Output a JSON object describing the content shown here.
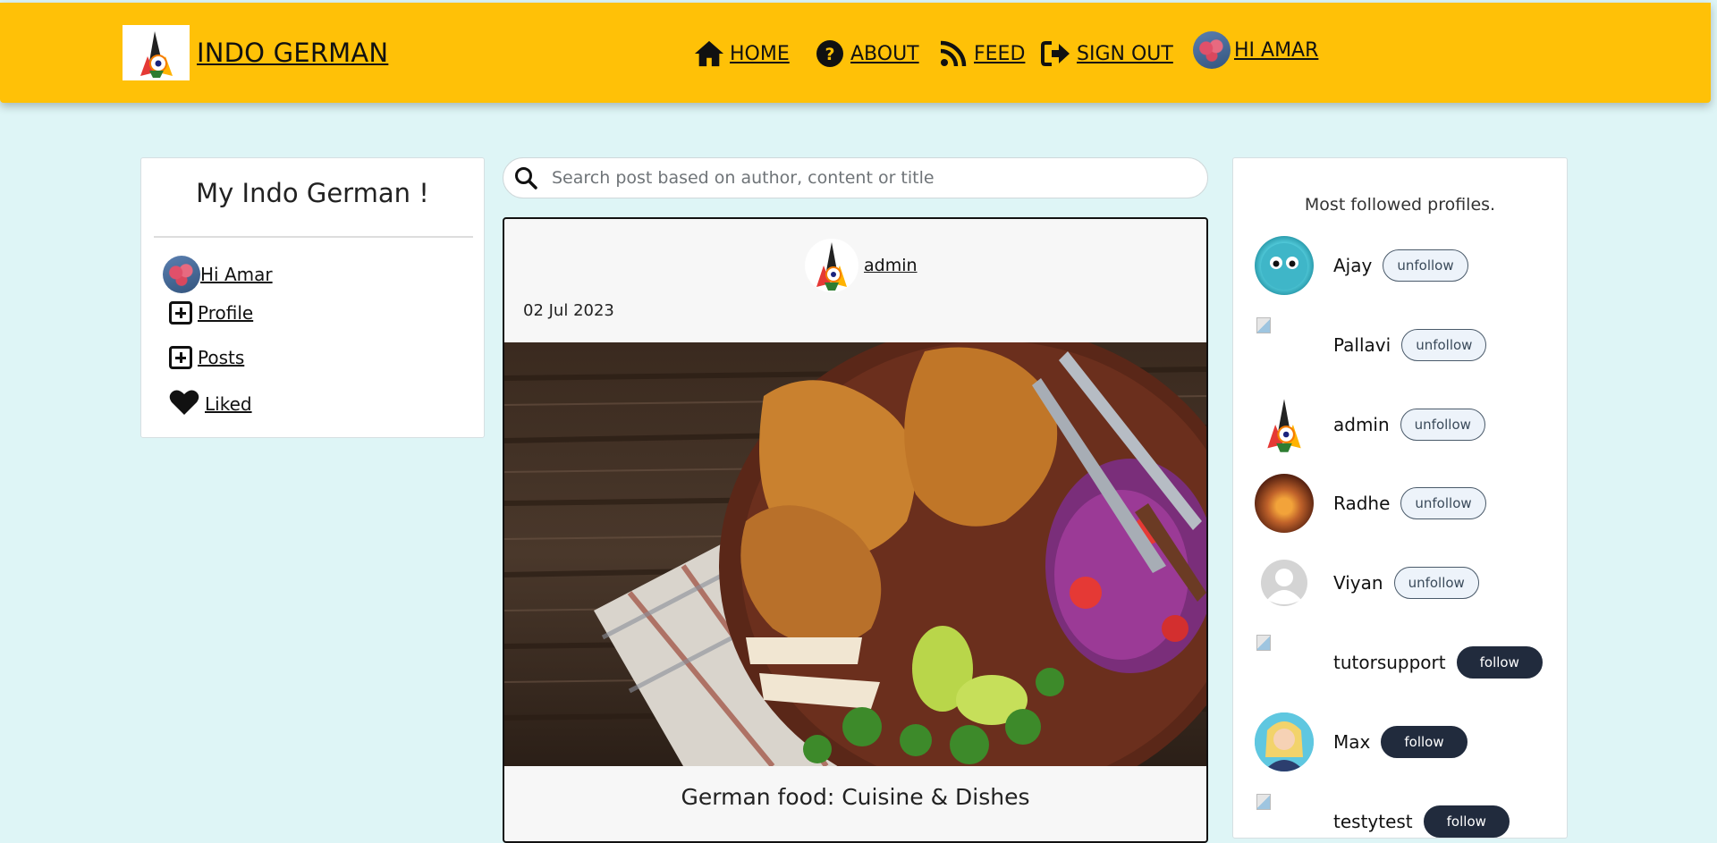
{
  "header": {
    "brand": "INDO GERMAN",
    "nav": [
      {
        "label": "HOME",
        "icon": "home-icon"
      },
      {
        "label": "ABOUT",
        "icon": "question-circle-icon"
      },
      {
        "label": "FEED",
        "icon": "rss-icon"
      },
      {
        "label": "SIGN OUT",
        "icon": "sign-out-icon"
      },
      {
        "label": " HI AMAR",
        "icon": "avatar"
      }
    ]
  },
  "left": {
    "title": "My Indo German !",
    "user": " Hi Amar",
    "items": [
      {
        "label": "Profile",
        "icon": "plus-square-icon"
      },
      {
        "label": "Posts",
        "icon": "plus-square-icon"
      },
      {
        "label": "Liked",
        "icon": "heart-icon"
      }
    ]
  },
  "search": {
    "placeholder": "Search post based on author, content or title",
    "value": ""
  },
  "post": {
    "author": "admin",
    "date": "02 Jul 2023",
    "title": "German food: Cuisine & Dishes"
  },
  "right": {
    "title": "Most followed profiles.",
    "profiles": [
      {
        "name": "Ajay",
        "action": "unfollow"
      },
      {
        "name": "Pallavi",
        "action": "unfollow"
      },
      {
        "name": "admin",
        "action": "unfollow"
      },
      {
        "name": "Radhe",
        "action": "unfollow"
      },
      {
        "name": "Viyan",
        "action": "unfollow"
      },
      {
        "name": "tutorsupport",
        "action": "follow"
      },
      {
        "name": "Max",
        "action": "follow"
      },
      {
        "name": "testytest",
        "action": "follow"
      }
    ]
  },
  "colors": {
    "header_bg": "#ffc107",
    "page_bg": "#def5f6",
    "follow_btn": "#212b3d",
    "unfollow_btn": "#edf3fa"
  }
}
